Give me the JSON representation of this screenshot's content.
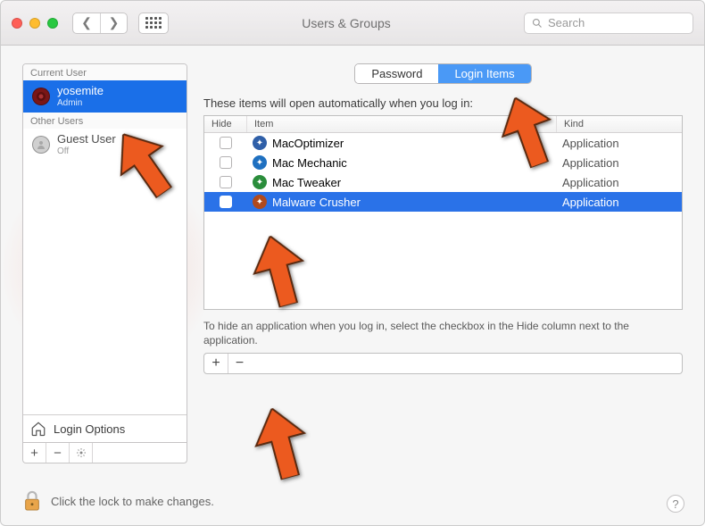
{
  "window": {
    "title": "Users & Groups"
  },
  "search": {
    "placeholder": "Search"
  },
  "sidebar": {
    "section_current": "Current User",
    "section_other": "Other Users",
    "current": {
      "name": "yosemite",
      "role": "Admin"
    },
    "guest": {
      "name": "Guest User",
      "role": "Off"
    },
    "login_options": "Login Options"
  },
  "tabs": {
    "password": "Password",
    "login_items": "Login Items"
  },
  "main": {
    "desc": "These items will open automatically when you log in:",
    "columns": {
      "hide": "Hide",
      "item": "Item",
      "kind": "Kind"
    },
    "rows": [
      {
        "name": "MacOptimizer",
        "kind": "Application",
        "icon_bg": "#2f5fa8",
        "selected": false
      },
      {
        "name": "Mac Mechanic",
        "kind": "Application",
        "icon_bg": "#1f70c0",
        "selected": false
      },
      {
        "name": "Mac Tweaker",
        "kind": "Application",
        "icon_bg": "#2a8d3b",
        "selected": false
      },
      {
        "name": "Malware Crusher",
        "kind": "Application",
        "icon_bg": "#b04a1e",
        "selected": true
      }
    ],
    "hint": "To hide an application when you log in, select the checkbox in the Hide column next to the application."
  },
  "footer": {
    "lock_text": "Click the lock to make changes."
  },
  "colors": {
    "accent": "#2a72e8",
    "arrow": "#ec5a1f",
    "arrow_stroke": "#5a2a10"
  }
}
